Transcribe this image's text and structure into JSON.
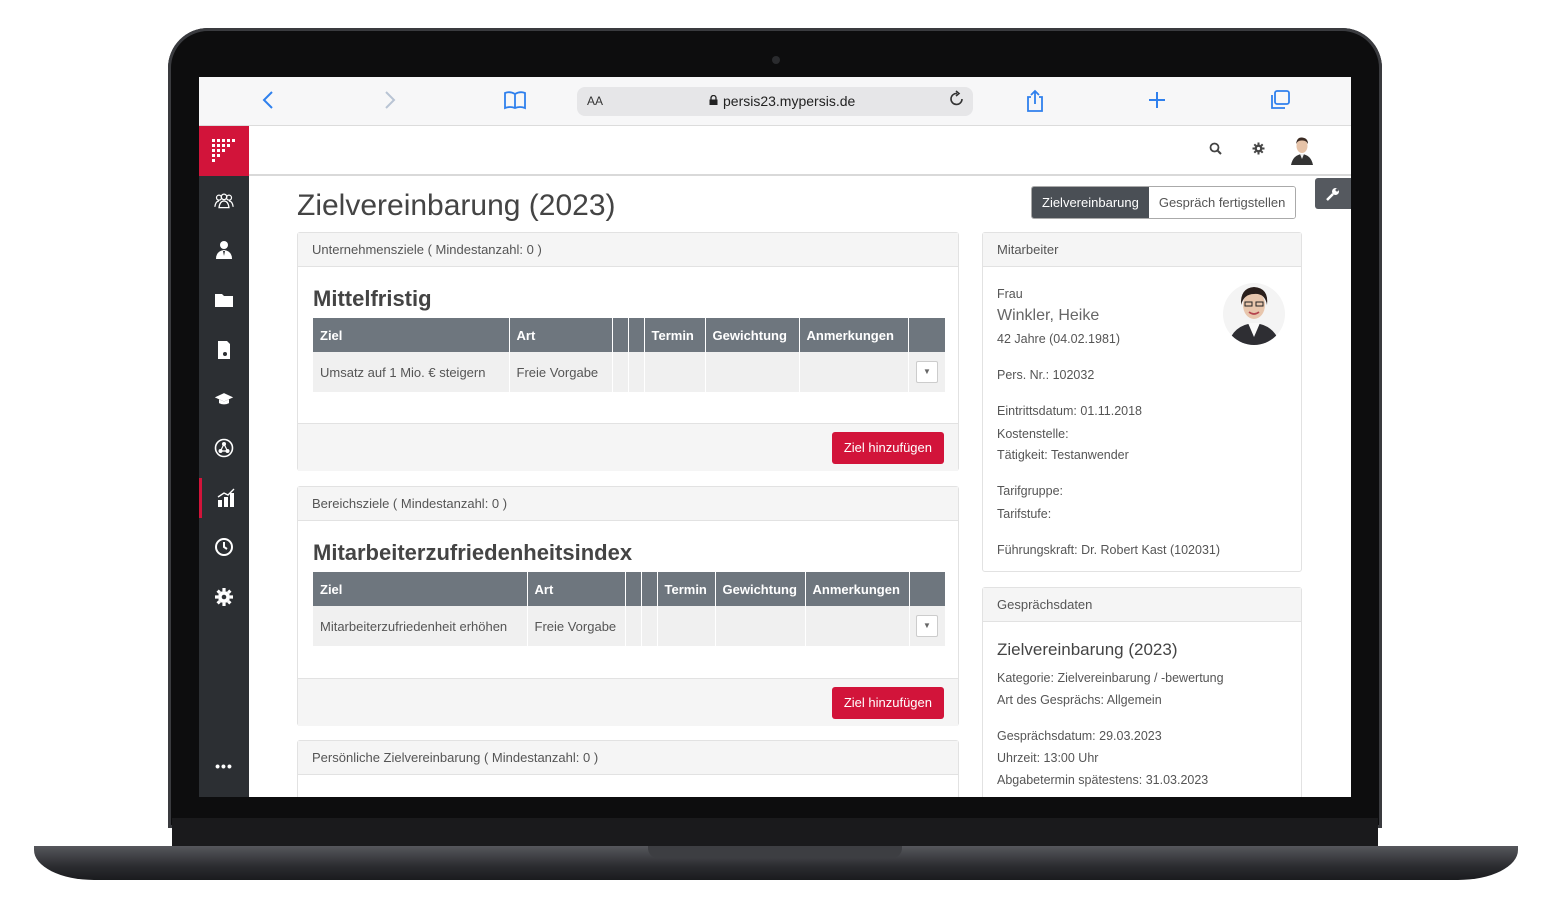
{
  "browser": {
    "text_size_label": "AA",
    "url": "persis23.mypersis.de"
  },
  "page": {
    "title": "Zielvereinbarung (2023)",
    "tabs": [
      {
        "label": "Zielvereinbarung",
        "active": true
      },
      {
        "label": "Gespräch fertigstellen",
        "active": false
      }
    ]
  },
  "sections": [
    {
      "header": "Unternehmensziele ( Mindestanzahl: 0 )",
      "group_title": "Mittelfristig",
      "columns": [
        "Ziel",
        "Art",
        "",
        "",
        "Termin",
        "Gewichtung",
        "Anmerkungen",
        ""
      ],
      "rows": [
        [
          "Umsatz auf 1 Mio. € steigern",
          "Freie Vorgabe",
          "",
          "",
          "",
          "",
          "",
          ""
        ]
      ],
      "add_label": "Ziel hinzufügen"
    },
    {
      "header": "Bereichsziele ( Mindestanzahl: 0 )",
      "group_title": "Mitarbeiterzufriedenheitsindex",
      "columns": [
        "Ziel",
        "Art",
        "",
        "",
        "Termin",
        "Gewichtung",
        "Anmerkungen",
        ""
      ],
      "rows": [
        [
          "Mitarbeiterzufriedenheit erhöhen",
          "Freie Vorgabe",
          "",
          "",
          "",
          "",
          "",
          ""
        ]
      ],
      "add_label": "Ziel hinzufügen"
    },
    {
      "header": "Persönliche Zielvereinbarung ( Mindestanzahl: 0 )"
    }
  ],
  "employee": {
    "header": "Mitarbeiter",
    "salutation": "Frau",
    "name": "Winkler, Heike",
    "age": "42 Jahre (04.02.1981)",
    "pers_nr": "Pers. Nr.: 102032",
    "entry_date": "Eintrittsdatum: 01.11.2018",
    "cost_center": "Kostenstelle:",
    "activity": "Tätigkeit: Testanwender",
    "tariff_group": "Tarifgruppe:",
    "tariff_level": "Tarifstufe:",
    "manager": "Führungskraft: Dr. Robert Kast (102031)"
  },
  "meeting": {
    "header": "Gesprächsdaten",
    "title": "Zielvereinbarung (2023)",
    "category": "Kategorie: Zielvereinbarung / -bewertung",
    "type": "Art des Gesprächs: Allgemein",
    "date": "Gesprächsdatum: 29.03.2023",
    "time": "Uhrzeit: 13:00 Uhr",
    "deadline": "Abgabetermin spätestens: 31.03.2023"
  },
  "sidebar": {
    "more_label": "•••",
    "items": [
      {
        "icon": "team-icon"
      },
      {
        "icon": "person-icon"
      },
      {
        "icon": "folder-icon"
      },
      {
        "icon": "document-icon"
      },
      {
        "icon": "graduation-cap-icon"
      },
      {
        "icon": "network-icon"
      },
      {
        "icon": "bar-chart-icon",
        "active": true
      },
      {
        "icon": "clock-icon"
      },
      {
        "icon": "gear-icon"
      }
    ]
  },
  "colors": {
    "accent": "#d2143a",
    "sidebar": "#2c2f33",
    "table_header": "#6e767e"
  }
}
